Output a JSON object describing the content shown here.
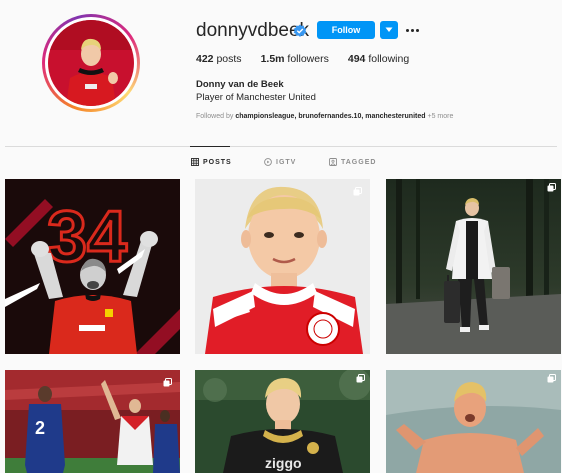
{
  "profile": {
    "username": "donnyvdbeek",
    "follow_label": "Follow",
    "stats": [
      {
        "count": "422",
        "label": "posts"
      },
      {
        "count": "1.5m",
        "label": "followers"
      },
      {
        "count": "494",
        "label": "following"
      }
    ],
    "full_name": "Donny van de Beek",
    "bio": "Player of Manchester United",
    "followed_prefix": "Followed by",
    "followed_by": "championsleague, brunofernandes.10, manchesterunited",
    "followed_more": "+5 more"
  },
  "tabs": [
    {
      "label": "POSTS",
      "icon": "grid-icon",
      "active": true
    },
    {
      "label": "IGTV",
      "icon": "igtv-icon",
      "active": false
    },
    {
      "label": "TAGGED",
      "icon": "tag-icon",
      "active": false
    }
  ],
  "posts": [
    {
      "overlay_text": "34"
    },
    {},
    {},
    {},
    {},
    {}
  ],
  "colors": {
    "accent": "#0095f6",
    "united_red": "#da291c"
  }
}
